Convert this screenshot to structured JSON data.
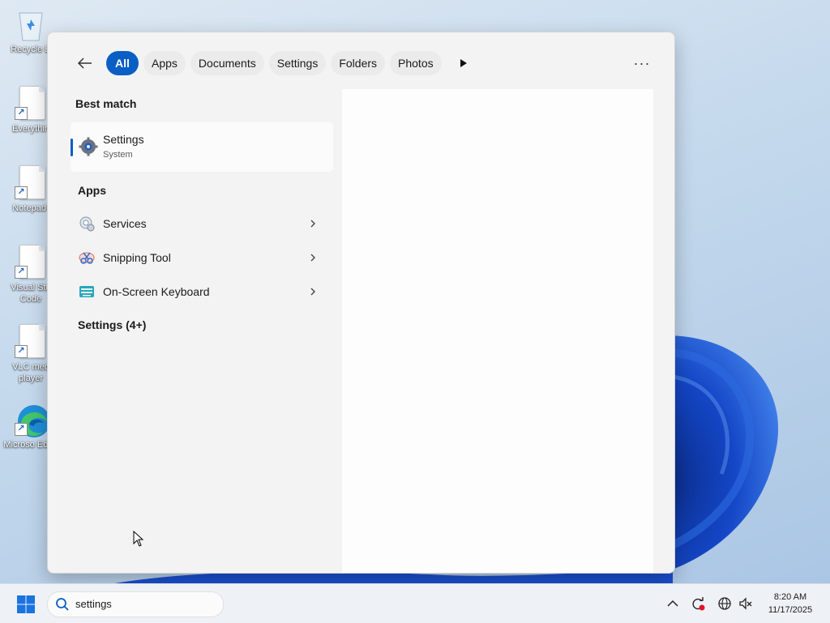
{
  "desktop": {
    "icons": [
      {
        "label": "Recycle B",
        "icon": "recycle-bin-icon"
      },
      {
        "label": "Everythin",
        "icon": "shortcut-file-icon"
      },
      {
        "label": "Notepad-",
        "icon": "shortcut-file-icon"
      },
      {
        "label": "Visual Stu Code",
        "icon": "shortcut-file-icon"
      },
      {
        "label": "VLC med player",
        "icon": "shortcut-file-icon"
      },
      {
        "label": "Microso Edge",
        "icon": "edge-icon"
      }
    ]
  },
  "search_panel": {
    "filters": [
      "All",
      "Apps",
      "Documents",
      "Settings",
      "Folders",
      "Photos"
    ],
    "active_filter": "All",
    "more_label": "···",
    "best_match": {
      "title": "Best match",
      "item": {
        "name": "Settings",
        "subtitle": "System",
        "icon": "gear-icon"
      }
    },
    "apps": {
      "title": "Apps",
      "items": [
        {
          "name": "Services",
          "icon": "services-icon"
        },
        {
          "name": "Snipping Tool",
          "icon": "snipping-tool-icon"
        },
        {
          "name": "On-Screen Keyboard",
          "icon": "keyboard-icon"
        }
      ]
    },
    "settings_section": {
      "title": "Settings (4+)"
    }
  },
  "taskbar": {
    "search_value": "settings",
    "clock": {
      "time": "8:20 AM",
      "date": "11/17/2025"
    },
    "tray_icons": [
      "chevron-up-icon",
      "sync-icon",
      "network-icon",
      "volume-muted-icon"
    ]
  },
  "colors": {
    "accent": "#0a5fc4"
  }
}
